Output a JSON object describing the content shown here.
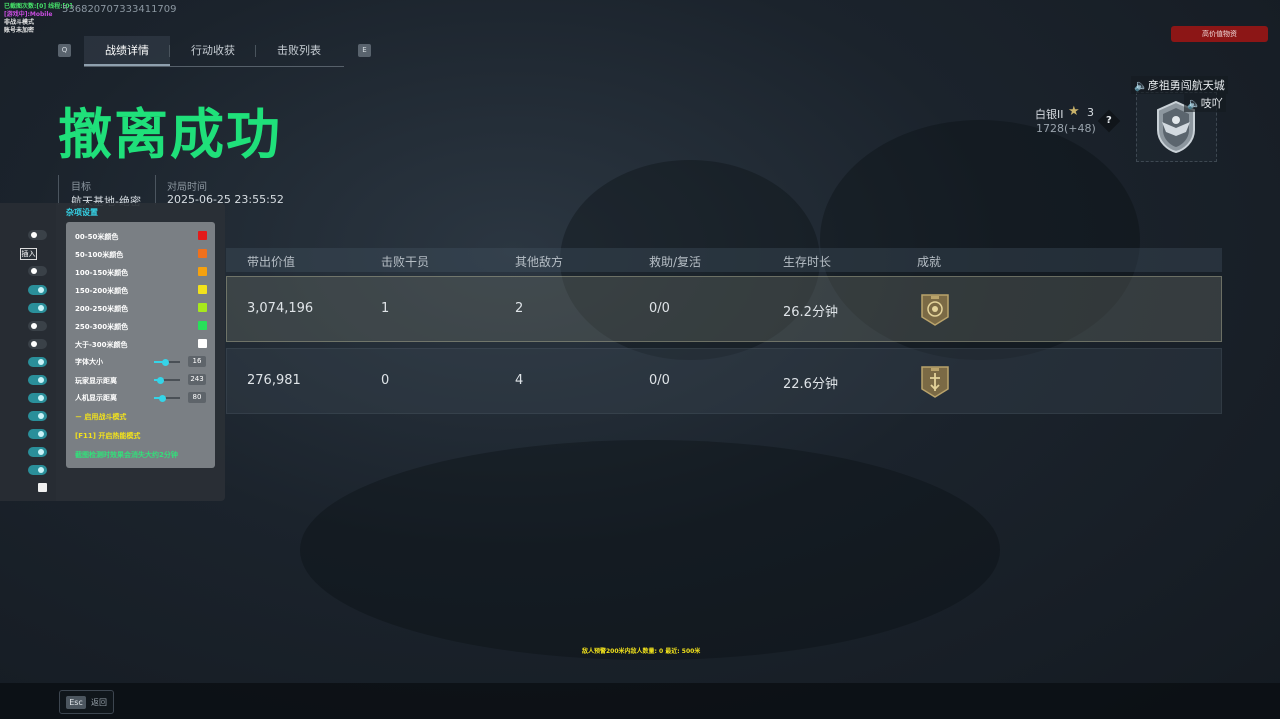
{
  "debug": {
    "line1": "已截图次数:[0] 线程:[0]",
    "line2": "[游戏中]:Mobile",
    "line3": "非战斗模式",
    "line4": "账号未加密",
    "session_id": "536820707333411709"
  },
  "keys": {
    "q": "Q",
    "e": "E",
    "esc": "Esc"
  },
  "tabs": [
    {
      "label": "战绩详情",
      "active": true
    },
    {
      "label": "行动收获",
      "active": false
    },
    {
      "label": "击败列表",
      "active": false
    }
  ],
  "high_value_button": "高价值物资",
  "result_title": "撤离成功",
  "info": {
    "target_label": "目标",
    "target_value": "航天基地-绝密",
    "time_label": "对局时间",
    "time_value": "2025-06-25 23:55:52"
  },
  "rank": {
    "name": "白银II",
    "stars": "3",
    "points": "1728(+48)",
    "help": "?"
  },
  "players": {
    "name1": "彦祖勇闯航天城",
    "name2": "吱吖"
  },
  "table": {
    "headers": [
      "带出价值",
      "击败干员",
      "其他敌方",
      "救助/复活",
      "生存时长",
      "成就"
    ],
    "rows": [
      {
        "value": "3,074,196",
        "kills": "1",
        "others": "2",
        "assists": "0/0",
        "survival": "26.2分钟",
        "selected": true
      },
      {
        "value": "276,981",
        "kills": "0",
        "others": "4",
        "assists": "0/0",
        "survival": "22.6分钟",
        "selected": false
      }
    ]
  },
  "settings_panel": {
    "title": "杂项设置",
    "insert_key": "插入",
    "color_options": [
      {
        "label": "00-50米颜色",
        "color": "#e21b1b"
      },
      {
        "label": "50-100米颜色",
        "color": "#f0701c"
      },
      {
        "label": "100-150米颜色",
        "color": "#f5a10f"
      },
      {
        "label": "150-200米颜色",
        "color": "#f2e21c"
      },
      {
        "label": "200-250米颜色",
        "color": "#a7e81c"
      },
      {
        "label": "250-300米颜色",
        "color": "#27e05a"
      },
      {
        "label": "大于-300米颜色",
        "color": "#ffffff"
      }
    ],
    "sliders": [
      {
        "label": "字体大小",
        "value": "16",
        "fraction": 0.45
      },
      {
        "label": "玩家显示距离",
        "value": "243",
        "fraction": 0.25
      },
      {
        "label": "人机显示距离",
        "value": "80",
        "fraction": 0.35
      }
    ],
    "battle_mode": "－ 启用战斗模式",
    "hotkey_mode": "[F11] 开启热能模式",
    "note": "截图检测时效果会消失大约2分钟"
  },
  "enemy_warning": "敌人预警200米内敌人数量: 0  最近: 500米",
  "back_label": "返回"
}
